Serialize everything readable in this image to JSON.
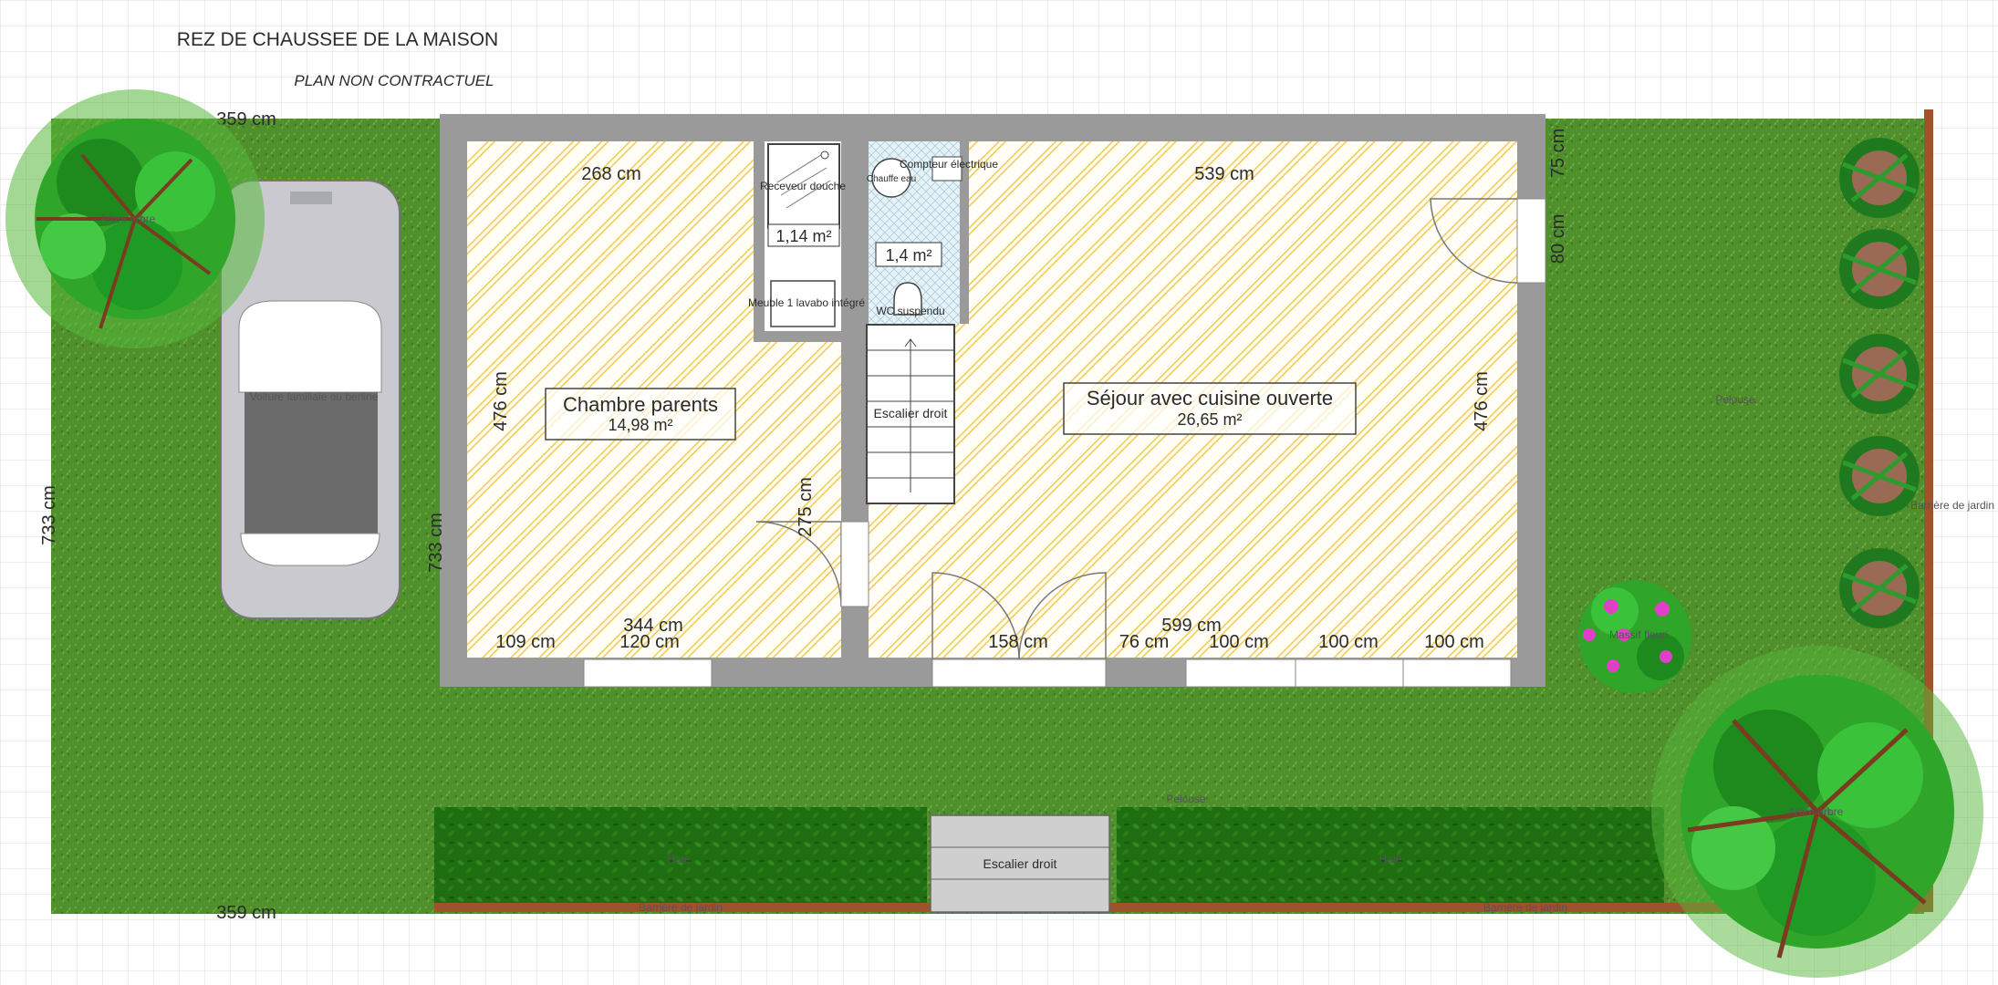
{
  "header": {
    "title": "REZ DE CHAUSSEE DE LA MAISON",
    "subtitle": "PLAN NON CONTRACTUEL"
  },
  "rooms": {
    "chambre": {
      "name": "Chambre parents",
      "area": "14,98 m²"
    },
    "sejour": {
      "name": "Séjour avec cuisine ouverte",
      "area": "26,65 m²"
    },
    "douche": {
      "area": "1,14 m²"
    },
    "wc": {
      "area": "1,4 m²"
    }
  },
  "dimensions": {
    "car_width_top": "359 cm",
    "car_width_bottom": "359 cm",
    "lot_height": "733 cm",
    "house_side": "733 cm",
    "chambre_width": "268 cm",
    "chambre_height": "476 cm",
    "sejour_width": "539 cm",
    "sejour_height": "476 cm",
    "right_top": "75 cm",
    "right_window": "80 cm",
    "door_height": "275 cm",
    "left_total": "344 cm",
    "left_w1": "109 cm",
    "left_w2": "120 cm",
    "right_total": "599 cm",
    "right_w1": "158 cm",
    "right_w2": "76 cm",
    "right_w3": "100 cm",
    "right_w4": "100 cm",
    "right_w5": "100 cm"
  },
  "objects": {
    "receveur": "Receveur douche",
    "meuble": "Meuble 1 lavabo intégré",
    "chauffe_eau": "Chauffe eau",
    "compteur": "Compteur électrique",
    "wc": "WC suspendu",
    "escalier_int": "Escalier droit",
    "escalier_ext": "Escalier droit",
    "voiture": "Voiture familiale ou berline",
    "arbre1": "Arbre arbre",
    "arbre2": "Arbre arbre",
    "pelouse1": "Pelouse",
    "pelouse2": "Pelouse",
    "haie1": "Haie",
    "haie2": "Haie",
    "barriere1": "Barrière de jardin",
    "barriere2": "Barrière de jardin",
    "barriere3": "Barrière de jardin",
    "massif": "Massif fleuri"
  },
  "colors": {
    "grass": "#4f8f2c",
    "wall": "#9a9a9a",
    "hatch": "#f2c94c",
    "hedge": "#1f6e12",
    "fence": "#a0522d"
  }
}
